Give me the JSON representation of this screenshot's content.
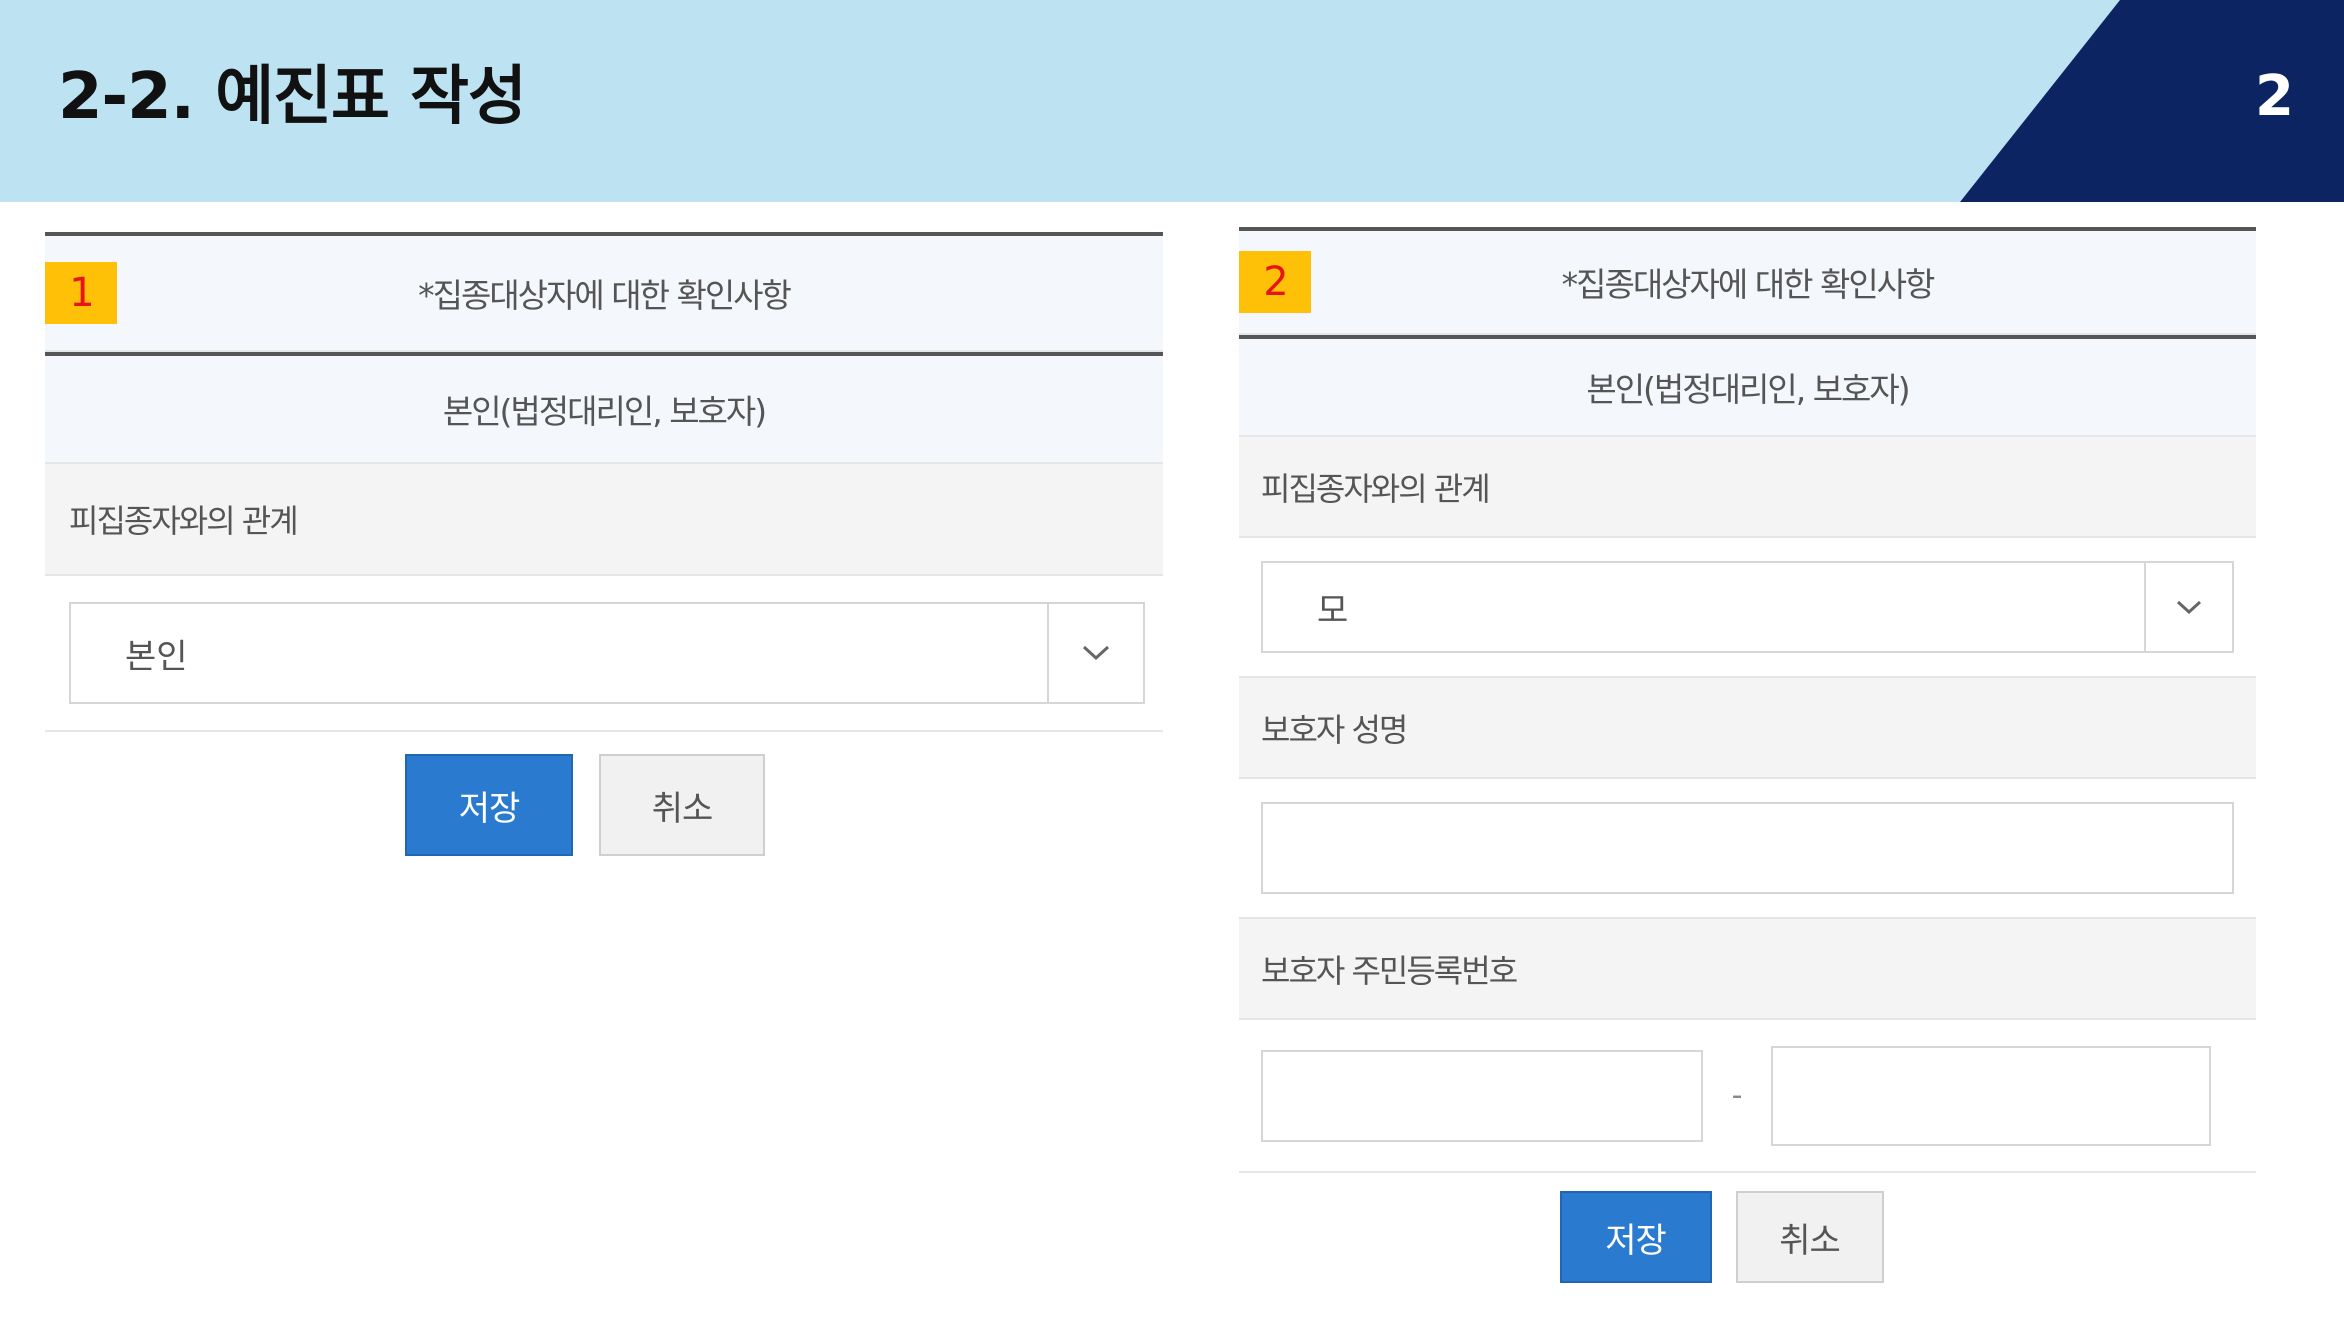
{
  "slide": {
    "title": "2-2. 예진표 작성",
    "page_number": "2",
    "colors": {
      "band": "#bde3f3",
      "dark": "#0c2461",
      "badge": "#ffc107",
      "badge_text": "#e8141c",
      "save": "#2a7bd0"
    }
  },
  "panel1": {
    "badge": "1",
    "section_title": "*집종대상자에 대한 확인사항",
    "subsection": "본인(법정대리인, 보호자)",
    "relation_label": "피집종자와의 관계",
    "relation_value": "본인",
    "save_label": "저장",
    "cancel_label": "취소"
  },
  "panel2": {
    "badge": "2",
    "section_title": "*집종대상자에 대한 확인사항",
    "subsection": "본인(법정대리인, 보호자)",
    "relation_label": "피집종자와의 관계",
    "relation_value": "모",
    "guardian_name_label": "보호자 성명",
    "guardian_name_value": "",
    "guardian_id_label": "보호자 주민등록번호",
    "guardian_id_front": "",
    "guardian_id_separator": "-",
    "guardian_id_back": "",
    "save_label": "저장",
    "cancel_label": "취소"
  }
}
